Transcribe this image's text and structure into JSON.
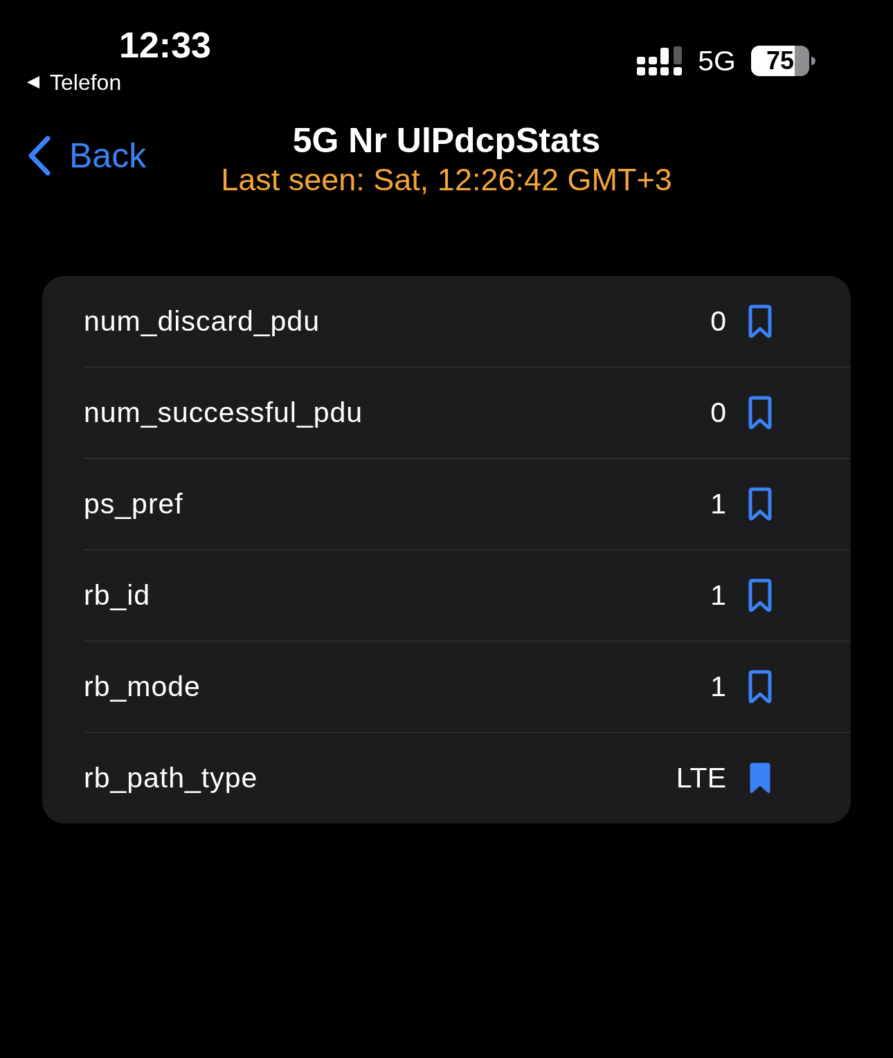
{
  "status_bar": {
    "time": "12:33",
    "back_app": "Telefon",
    "network": "5G",
    "battery": "75"
  },
  "nav": {
    "back": "Back",
    "title": "5G Nr UlPdcpStats",
    "subtitle": "Last seen: Sat, 12:26:42 GMT+3"
  },
  "rows": [
    {
      "name": "num_discard_pdu",
      "value": "0",
      "bookmarked": false
    },
    {
      "name": "num_successful_pdu",
      "value": "0",
      "bookmarked": false
    },
    {
      "name": "ps_pref",
      "value": "1",
      "bookmarked": false
    },
    {
      "name": "rb_id",
      "value": "1",
      "bookmarked": false
    },
    {
      "name": "rb_mode",
      "value": "1",
      "bookmarked": false
    },
    {
      "name": "rb_path_type",
      "value": "LTE",
      "bookmarked": true
    }
  ]
}
